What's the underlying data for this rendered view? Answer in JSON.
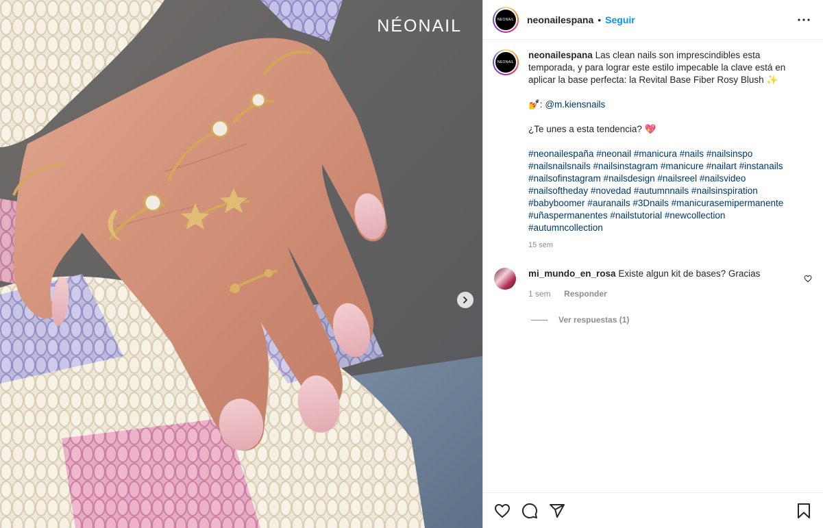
{
  "media": {
    "watermark": "NÉONAIL",
    "next_icon": "chevron-right-icon"
  },
  "header": {
    "avatar_text": "NEONAIL",
    "username": "neonailespana",
    "separator": "•",
    "follow_label": "Seguir",
    "more_icon": "more-horizontal-icon"
  },
  "caption": {
    "username": "neonailespana",
    "text": "Las clean nails son imprescindibles esta temporada, y para lograr este estilo impecable la clave está en aplicar la base perfecta: la Revital Base Fiber Rosy Blush ✨",
    "credit_prefix": "💅: ",
    "credit_mention": "@m.kiensnails",
    "question": "¿Te unes a esta tendencia? 💖",
    "hashtags": "#neonailespaña #neonail #manicura #nails #nailsinspo #nailsnailsnails #nailsinstagram #manicure #nailart #instanails #nailsofinstagram #nailsdesign #nailsreel #nailsvideo #nailsoftheday #novedad #autumnnails #nailsinspiration #babyboomer #auranails #3Dnails #manicurasemipermanente #uñaspermanentes #nailstutorial #newcollection #autumncollection",
    "time": "15 sem"
  },
  "comments": [
    {
      "username": "mi_mundo_en_rosa",
      "text": "Existe algun kit de bases? Gracias",
      "time": "1 sem",
      "reply_label": "Responder",
      "view_replies": "Ver respuestas (1)"
    }
  ],
  "actions": {
    "like_icon": "heart-icon",
    "comment_icon": "comment-icon",
    "share_icon": "share-icon",
    "save_icon": "bookmark-icon"
  }
}
